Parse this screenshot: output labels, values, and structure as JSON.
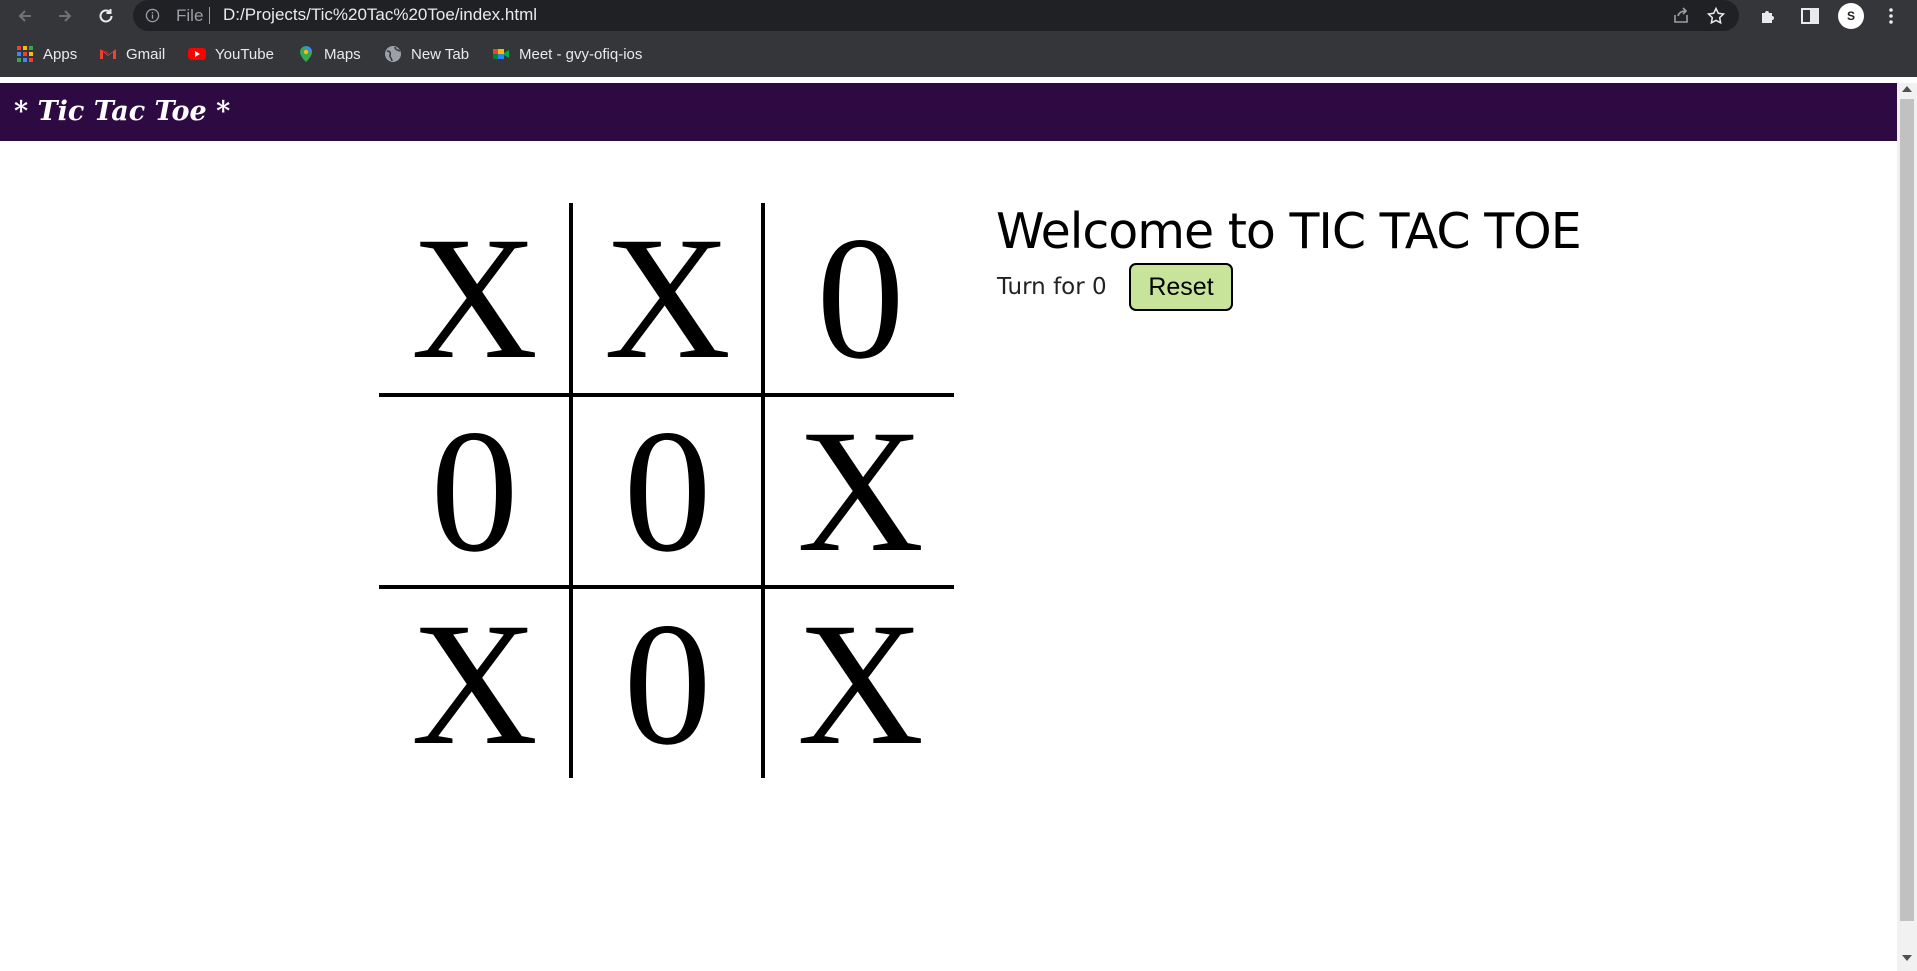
{
  "browser": {
    "omnibox": {
      "scheme_label": "File",
      "url": "D:/Projects/Tic%20Tac%20Toe/index.html"
    },
    "profile_initial": "S",
    "bookmarks": [
      {
        "label": "Apps",
        "icon": "apps-grid-icon"
      },
      {
        "label": "Gmail",
        "icon": "gmail-icon"
      },
      {
        "label": "YouTube",
        "icon": "youtube-icon"
      },
      {
        "label": "Maps",
        "icon": "maps-icon"
      },
      {
        "label": "New Tab",
        "icon": "globe-icon"
      },
      {
        "label": "Meet - gvy-ofiq-ios",
        "icon": "meet-icon"
      }
    ]
  },
  "site": {
    "title": "* Tic Tac Toe *",
    "header_color": "#2e0a43"
  },
  "game": {
    "board": [
      [
        "X",
        "X",
        "0"
      ],
      [
        "0",
        "0",
        "X"
      ],
      [
        "X",
        "0",
        "X"
      ]
    ],
    "welcome": "Welcome to TIC TAC TOE",
    "turn_text": "Turn for 0",
    "reset_label": "Reset",
    "reset_color": "#c8e39a"
  }
}
